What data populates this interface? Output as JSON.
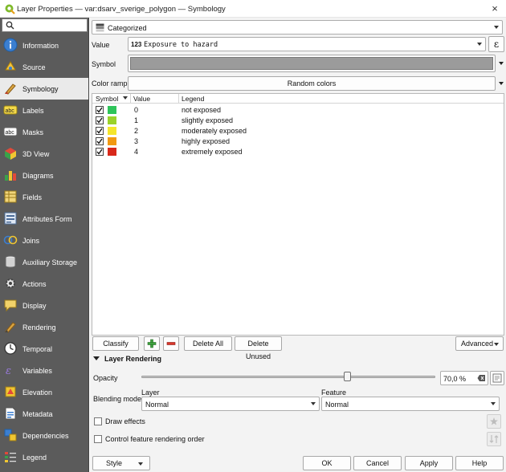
{
  "window": {
    "title": "Layer Properties — var:dsarv_sverige_polygon — Symbology",
    "close_icon": "×"
  },
  "sidebar": {
    "search_placeholder": "",
    "items": [
      {
        "label": "Information",
        "icon": "info-icon"
      },
      {
        "label": "Source",
        "icon": "source-icon"
      },
      {
        "label": "Symbology",
        "icon": "symbology-icon",
        "active": true
      },
      {
        "label": "Labels",
        "icon": "labels-icon"
      },
      {
        "label": "Masks",
        "icon": "masks-icon"
      },
      {
        "label": "3D View",
        "icon": "3d-view-icon"
      },
      {
        "label": "Diagrams",
        "icon": "diagrams-icon"
      },
      {
        "label": "Fields",
        "icon": "fields-icon"
      },
      {
        "label": "Attributes Form",
        "icon": "attributes-form-icon"
      },
      {
        "label": "Joins",
        "icon": "joins-icon"
      },
      {
        "label": "Auxiliary Storage",
        "icon": "auxiliary-storage-icon"
      },
      {
        "label": "Actions",
        "icon": "actions-icon"
      },
      {
        "label": "Display",
        "icon": "display-icon"
      },
      {
        "label": "Rendering",
        "icon": "rendering-icon"
      },
      {
        "label": "Temporal",
        "icon": "temporal-icon"
      },
      {
        "label": "Variables",
        "icon": "variables-icon"
      },
      {
        "label": "Elevation",
        "icon": "elevation-icon"
      },
      {
        "label": "Metadata",
        "icon": "metadata-icon"
      },
      {
        "label": "Dependencies",
        "icon": "dependencies-icon"
      },
      {
        "label": "Legend",
        "icon": "legend-icon"
      }
    ]
  },
  "renderer": {
    "type": "Categorized"
  },
  "value": {
    "label": "Value",
    "type_badge": "123",
    "field": "Exposure to hazard",
    "expression_icon": "ε"
  },
  "symbol": {
    "label": "Symbol",
    "color": "#9b9b9b"
  },
  "color_ramp": {
    "label": "Color ramp",
    "value": "Random colors"
  },
  "table": {
    "headers": {
      "symbol": "Symbol",
      "value": "Value",
      "legend": "Legend"
    },
    "rows": [
      {
        "checked": true,
        "color": "#2ec45a",
        "value": "0",
        "legend": "not exposed"
      },
      {
        "checked": true,
        "color": "#9ad22b",
        "value": "1",
        "legend": "slightly exposed"
      },
      {
        "checked": true,
        "color": "#f4e62c",
        "value": "2",
        "legend": "moderately exposed"
      },
      {
        "checked": true,
        "color": "#f19a12",
        "value": "3",
        "legend": "highly exposed"
      },
      {
        "checked": true,
        "color": "#d8281a",
        "value": "4",
        "legend": "extremely exposed"
      }
    ]
  },
  "actions": {
    "classify": "Classify",
    "delete_all": "Delete All",
    "delete_unused": "Delete Unused",
    "advanced": "Advanced"
  },
  "layer_rendering": {
    "title": "Layer Rendering",
    "opacity_label": "Opacity",
    "opacity_value": "70,0 %",
    "opacity_fraction": 0.7,
    "blending_label": "Blending mode",
    "layer_label": "Layer",
    "layer_value": "Normal",
    "feature_label": "Feature",
    "feature_value": "Normal",
    "draw_effects": "Draw effects",
    "control_order": "Control feature rendering order"
  },
  "footer": {
    "style": "Style",
    "ok": "OK",
    "cancel": "Cancel",
    "apply": "Apply",
    "help": "Help"
  }
}
